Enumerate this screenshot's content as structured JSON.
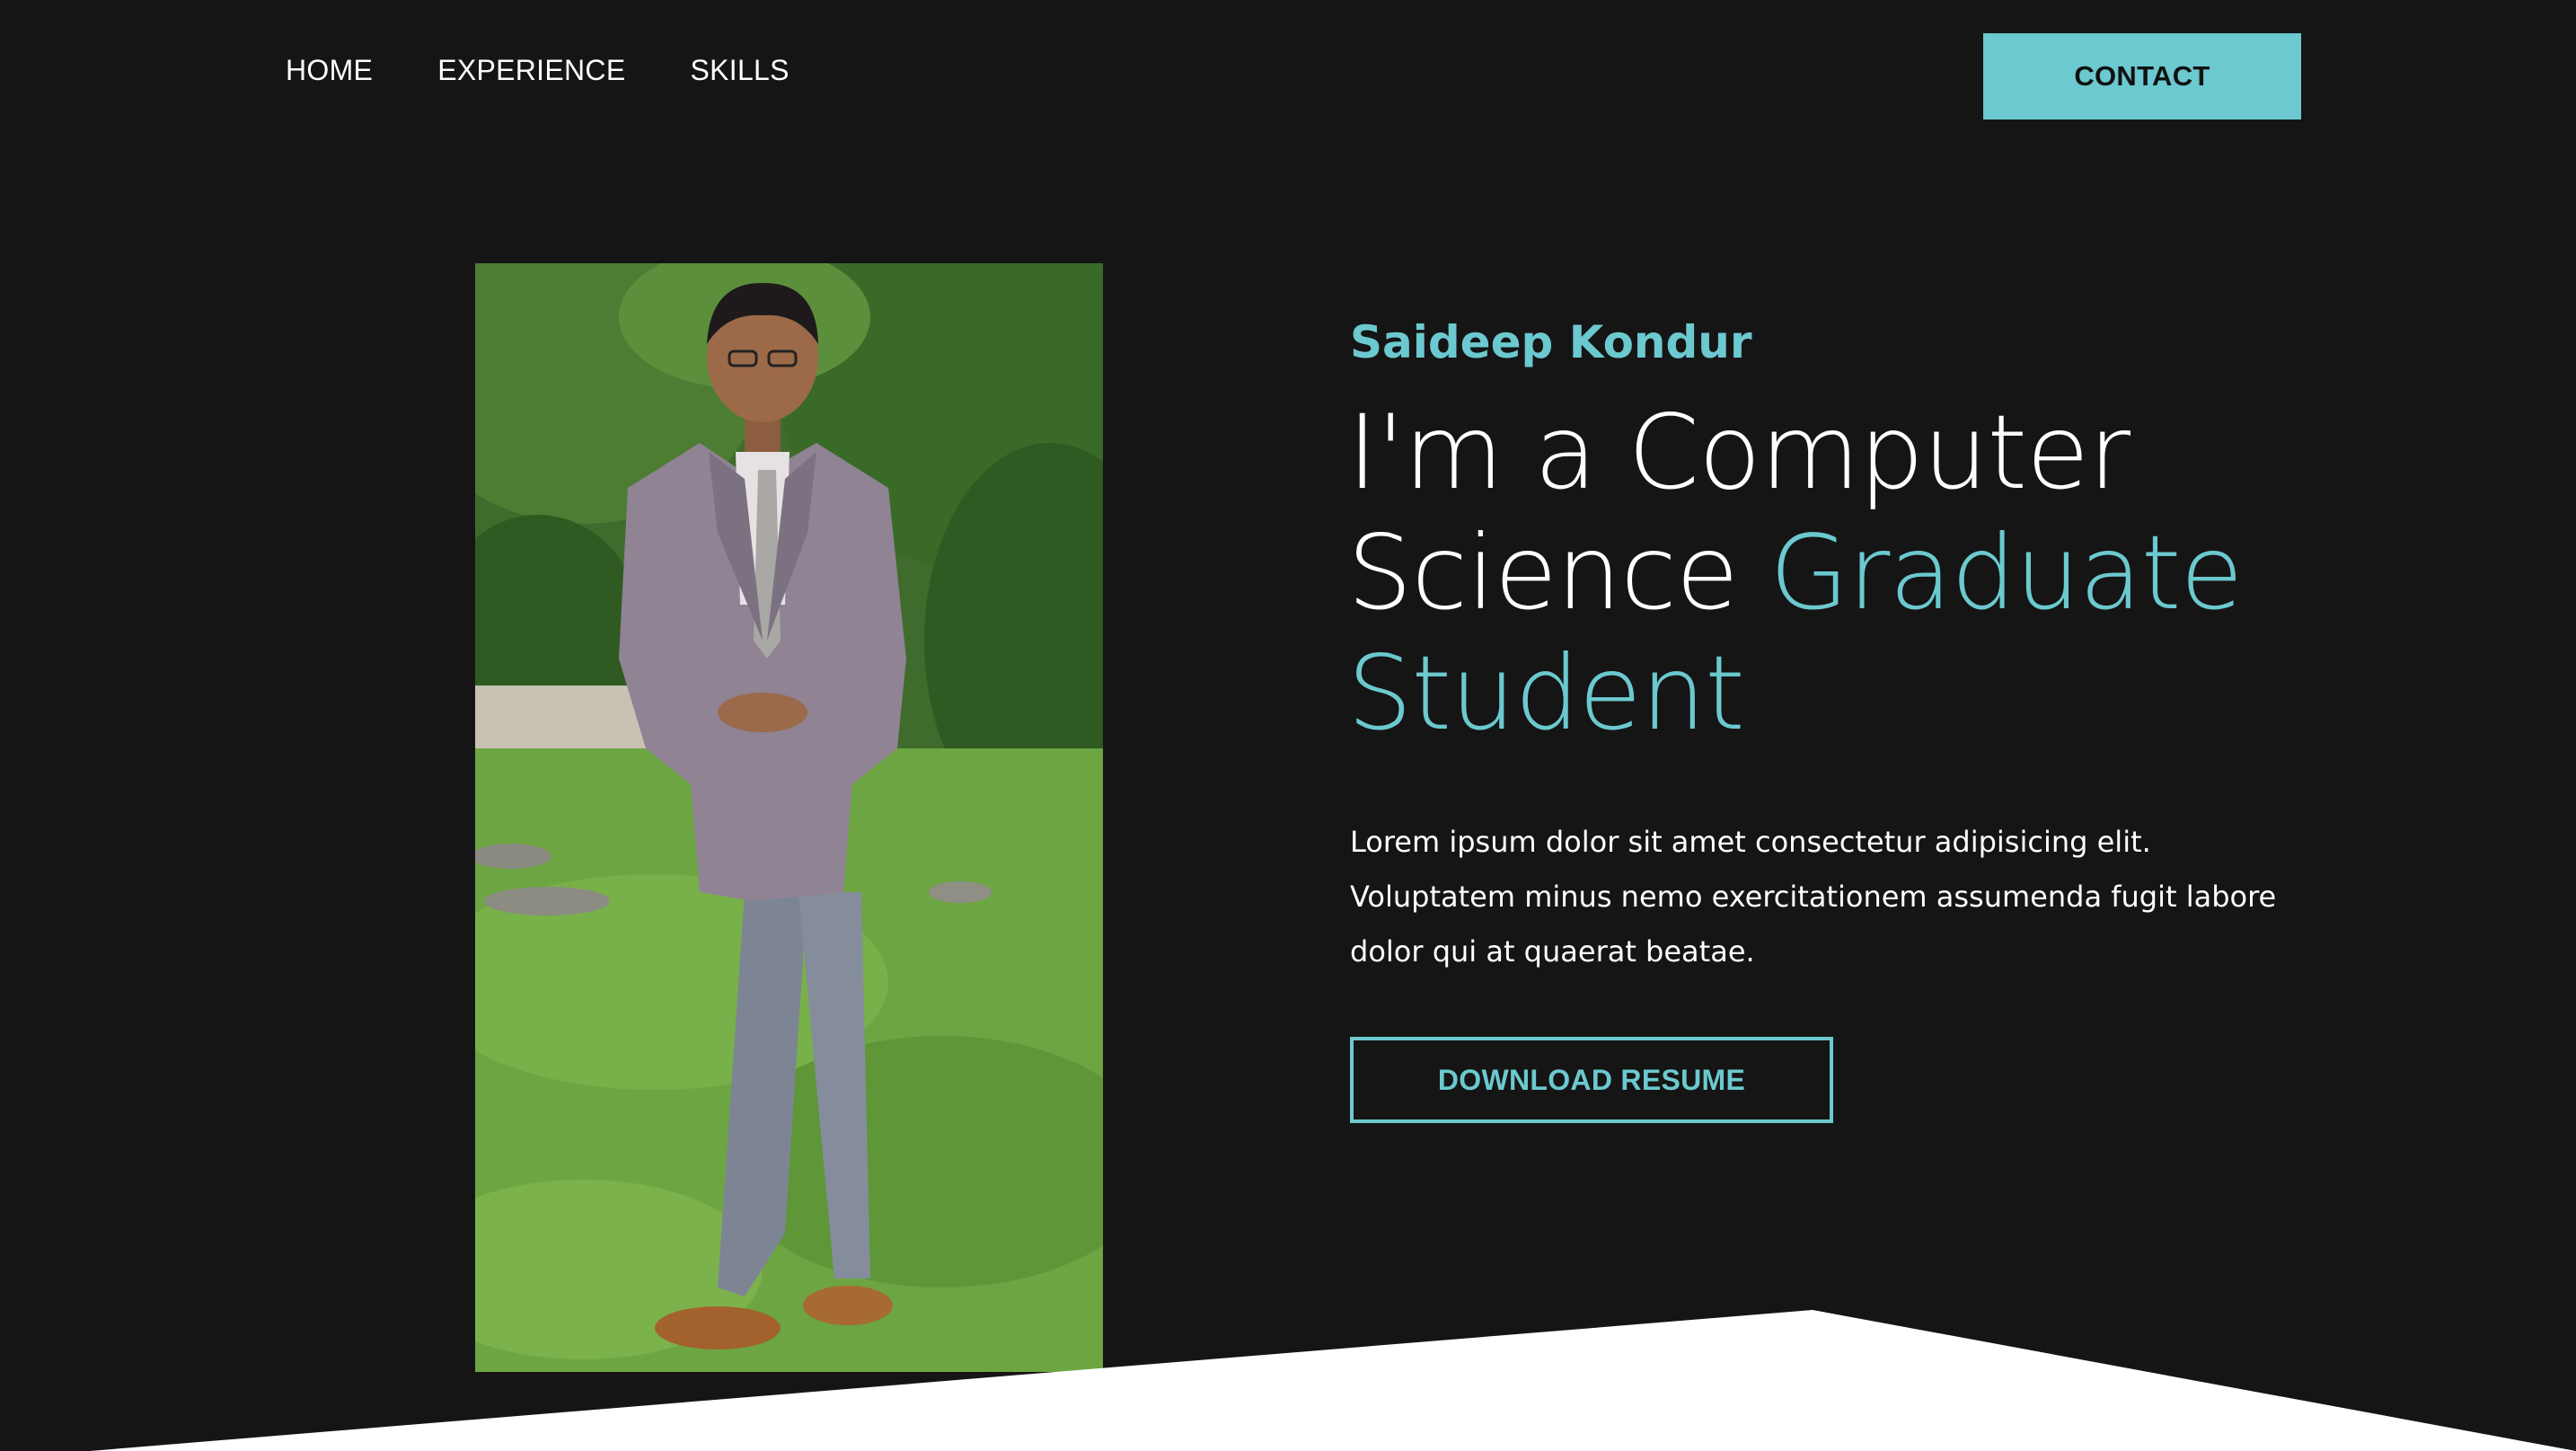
{
  "nav": {
    "items": [
      {
        "label": "HOME"
      },
      {
        "label": "EXPERIENCE"
      },
      {
        "label": "SKILLS"
      }
    ],
    "contact_label": "CONTACT"
  },
  "hero": {
    "name": "Saideep Kondur",
    "title_part1": "I'm a Computer Science ",
    "title_accent": "Graduate Student",
    "description": "Lorem ipsum dolor sit amet consectetur adipisicing elit. Voluptatem minus nemo exercitationem assumenda fugit labore dolor qui at quaerat beatae.",
    "resume_label": "DOWNLOAD RESUME"
  },
  "colors": {
    "background": "#151515",
    "accent": "#6bc9cf",
    "text": "#ffffff"
  }
}
